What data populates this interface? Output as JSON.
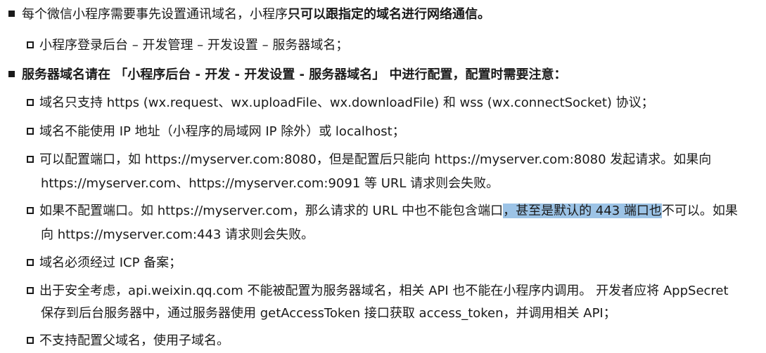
{
  "section1": {
    "prefix": "每个微信小程序需要事先设置通讯域名，小程序",
    "bold": "只可以跟指定的域名进行网络通信。",
    "sub1": "小程序登录后台 – 开发管理 – 开发设置 – 服务器域名；"
  },
  "section2": {
    "heading": "服务器域名请在 「小程序后台 - 开发 - 开发设置 - 服务器域名」 中进行配置，配置时需要注意：",
    "items": [
      {
        "line1": "域名只支持 https (wx.request、wx.uploadFile、wx.downloadFile) 和 wss (wx.connectSocket) 协议；"
      },
      {
        "line1": "域名不能使用 IP 地址（小程序的局域网 IP 除外）或 localhost；"
      },
      {
        "line1": "可以配置端口，如 https://myserver.com:8080，但是配置后只能向 https://myserver.com:8080 发起请求。如果向",
        "line2": "https://myserver.com、https://myserver.com:9091 等 URL 请求则会失败。"
      },
      {
        "line1_a": "如果不配置端口。如 https://myserver.com，那么请求的 URL 中也不能包含端口",
        "line1_hl": "，甚至是默认的 443 端口也",
        "line1_b": "不可以。如果",
        "line2": "向 https://myserver.com:443 请求则会失败。"
      },
      {
        "line1": "域名必须经过 ICP 备案；"
      },
      {
        "line1": "出于安全考虑，api.weixin.qq.com 不能被配置为服务器域名，相关 API 也不能在小程序内调用。 开发者应将 AppSecret",
        "line2": "保存到后台服务器中，通过服务器使用 getAccessToken 接口获取 access_token，并调用相关 API；"
      },
      {
        "line1": "不支持配置父域名，使用子域名。"
      }
    ]
  },
  "colors": {
    "text": "#1a1a1a",
    "highlight": "#9cc3e6"
  }
}
